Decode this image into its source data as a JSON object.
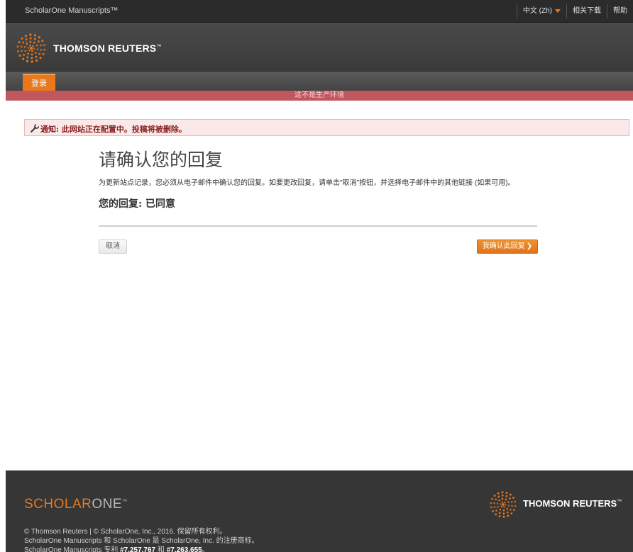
{
  "topbar": {
    "app_name": "ScholarOne Manuscripts™",
    "language": "中文 (Zh)",
    "downloads": "相关下载",
    "help": "帮助"
  },
  "brand": {
    "logo_text": "THOMSON REUTERS",
    "logo_tm": "™"
  },
  "nav": {
    "login_tab": "登录"
  },
  "env_banner": "这不是生产环境",
  "notice": {
    "text": "通知: 此网站正在配置中。投稿将被删除。",
    "icon": "wrench-icon"
  },
  "main": {
    "title": "请确认您的回复",
    "description": "为更新站点记录，您必须从电子邮件中确认您的回复。如要更改回复，请单击\"取消\"按钮，并选择电子邮件中的其他链接 (如果可用)。",
    "reply_status": "您的回复: 已同意",
    "cancel_label": "取消",
    "confirm_label": "我确认此回复",
    "confirm_icon": "chevron-right-icon"
  },
  "footer": {
    "so_part1": "SCHOLAR",
    "so_part2": "ONE",
    "so_tm": "™",
    "tr_text": "THOMSON REUTERS",
    "tr_tm": "™",
    "copy_line1": "© Thomson Reuters | © ScholarOne, Inc., 2016. 保留所有权利。",
    "copy_line2": "ScholarOne Manuscripts 和 ScholarOne 是 ScholarOne, Inc. 的注册商标。",
    "copy_line3_pre": "ScholarOne Manuscripts 专利",
    "copy_line3_p1": "#7,257,767",
    "copy_line3_and": "和",
    "copy_line3_p2": "#7,263,655",
    "copy_line3_end": "。"
  },
  "colors": {
    "accent": "#e8781e",
    "env_banner": "#c0575d",
    "notice_bg": "#fbe9e9",
    "dark": "#363636"
  }
}
